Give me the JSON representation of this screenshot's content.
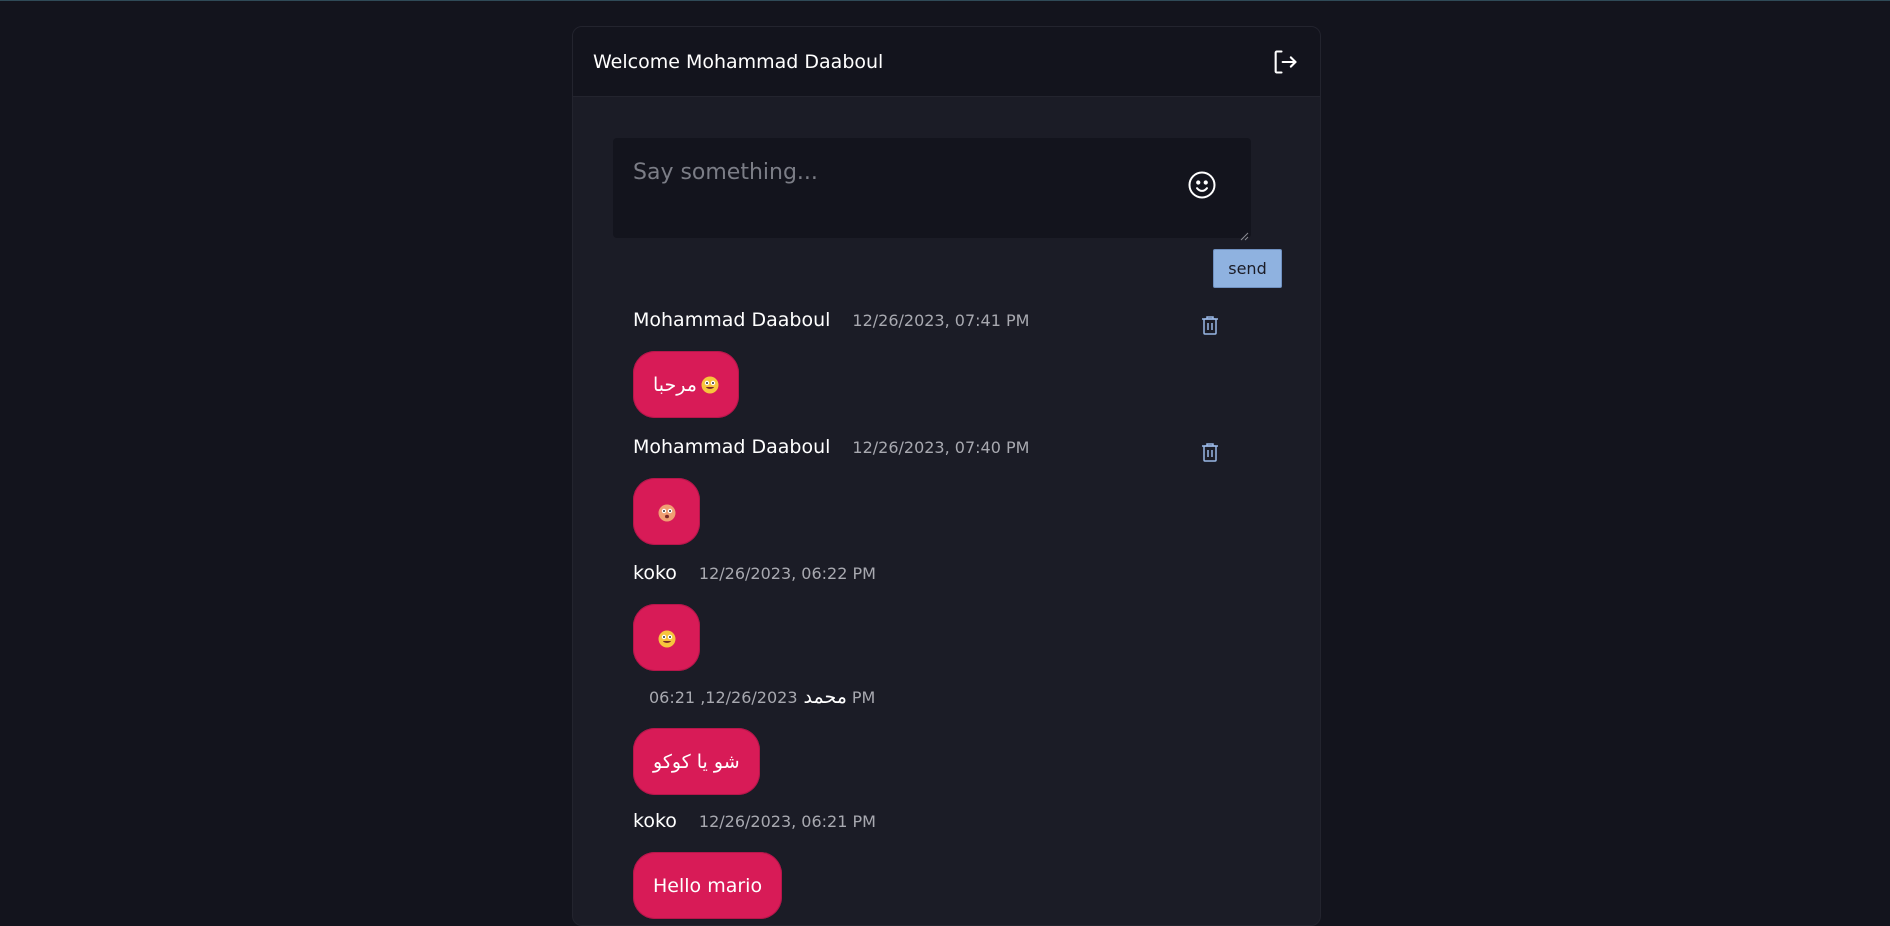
{
  "header": {
    "welcome": "Welcome Mohammad Daaboul"
  },
  "composer": {
    "placeholder": "Say something...",
    "send_label": "send"
  },
  "messages": [
    {
      "author": "Mohammad Daaboul",
      "time": "12/26/2023, 07:41 PM",
      "text": "مرحبا",
      "emoji": "laughing-face",
      "deletable": true
    },
    {
      "author": "Mohammad Daaboul",
      "time": "12/26/2023, 07:40 PM",
      "text": "",
      "emoji": "surprised-face",
      "deletable": true
    },
    {
      "author": "koko",
      "time": "12/26/2023, 06:22 PM",
      "text": "",
      "emoji": "laughing-face",
      "deletable": false
    },
    {
      "author": "محمد",
      "time": "12/26/2023, 06:21 PM",
      "time_display": "06:21 ,12/26/2023",
      "time_suffix": "PM",
      "text": "شو يا كوكو",
      "deletable": false
    },
    {
      "author": "koko",
      "time": "12/26/2023, 06:21 PM",
      "text": "Hello mario",
      "deletable": false
    }
  ],
  "colors": {
    "background": "#13141d",
    "card": "#1b1c26",
    "bubble": "#d81b57",
    "send": "#8fb2e0"
  },
  "icons": {
    "logout": "logout-icon",
    "emoji": "smiley-icon",
    "delete": "trash-icon"
  }
}
